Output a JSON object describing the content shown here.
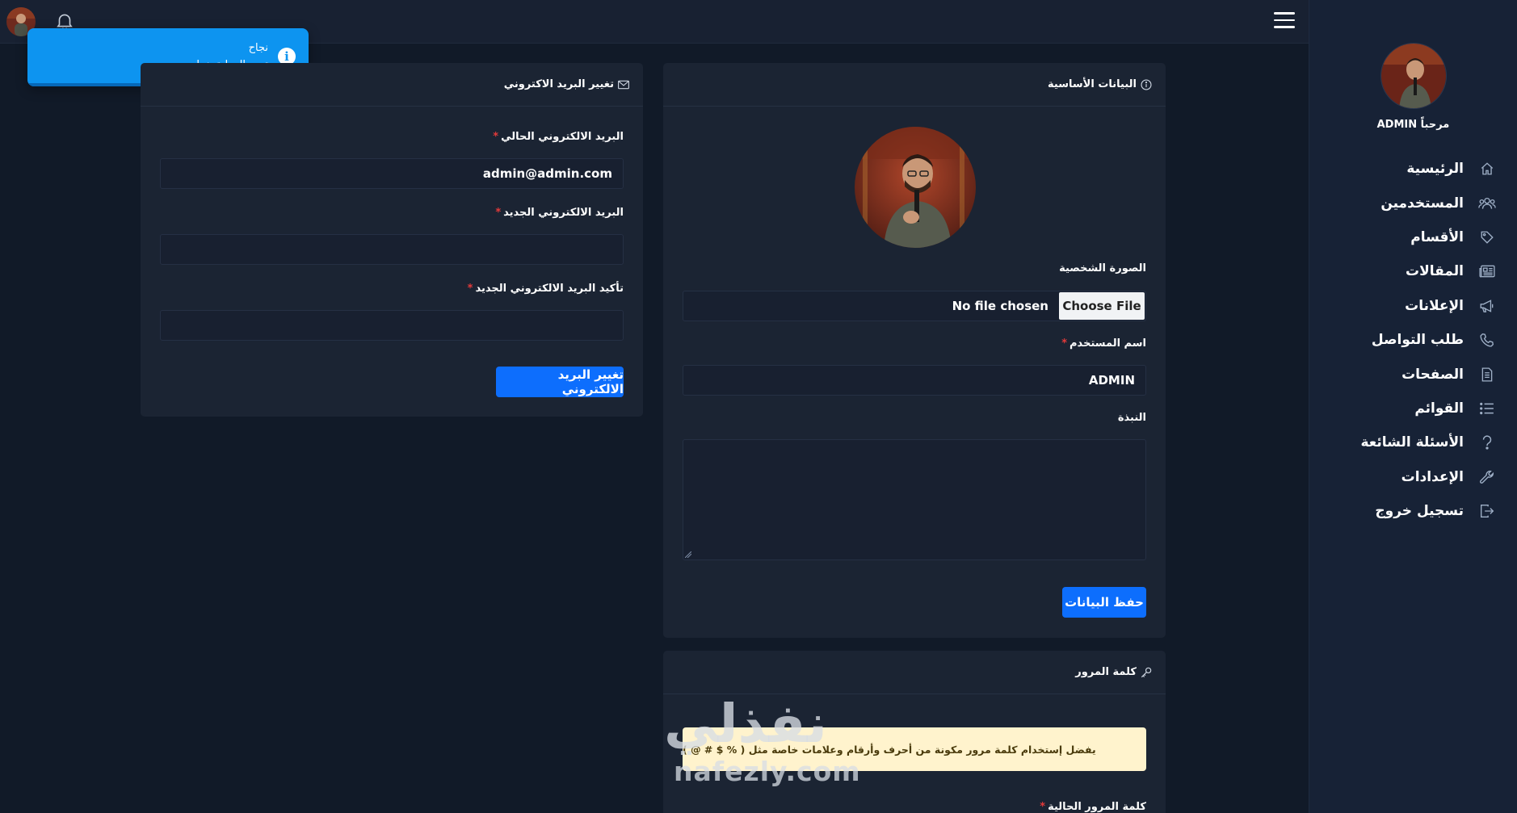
{
  "topbar": {
    "avatar_icon": "user-avatar",
    "notification_icon": "bell-icon",
    "menu_icon": "hamburger-menu-icon"
  },
  "toast": {
    "title": "نجاح",
    "message": "تمت العملية بنجاح",
    "icon": "info-icon",
    "color": "#0d94f0"
  },
  "sidebar": {
    "welcome": "مرحباً ADMIN",
    "items": [
      {
        "label": "الرئيسية",
        "icon": "home-icon"
      },
      {
        "label": "المستخدمين",
        "icon": "users-icon"
      },
      {
        "label": "الأقسام",
        "icon": "tag-icon"
      },
      {
        "label": "المقالات",
        "icon": "newspaper-icon"
      },
      {
        "label": "الإعلانات",
        "icon": "megaphone-icon"
      },
      {
        "label": "طلب التواصل",
        "icon": "phone-icon"
      },
      {
        "label": "الصفحات",
        "icon": "page-icon"
      },
      {
        "label": "القوائم",
        "icon": "list-icon"
      },
      {
        "label": "الأسئلة الشائعة",
        "icon": "question-icon"
      },
      {
        "label": "الإعدادات",
        "icon": "wrench-icon"
      },
      {
        "label": "تسجيل خروج",
        "icon": "logout-icon"
      }
    ]
  },
  "basic_info": {
    "title": "البيانات الأساسية",
    "photo_label": "الصورة الشخصية",
    "file_button": "Choose File",
    "file_status": "No file chosen",
    "username_label": "اسم المستخدم",
    "username_value": "ADMIN",
    "bio_label": "النبذة",
    "bio_value": "",
    "save_button": "حفظ البيانات"
  },
  "email_change": {
    "title": "تغيير البريد الاكتروني",
    "current_label": "البريد الالكتروني الحالي",
    "current_value": "admin@admin.com",
    "new_label": "البريد الالكتروني الجديد",
    "new_value": "",
    "confirm_label": "تأكيد البريد الالكتروني الجديد",
    "confirm_value": "",
    "submit_button": "تغيير البريد الالكتروني"
  },
  "password": {
    "title": "كلمة المرور",
    "hint": "يفضل إستخدام كلمة مرور مكونة من أحرف وأرقام وعلامات خاصة مثل ( % $ # @ )",
    "current_label": "كلمة المرور الحالية"
  },
  "required_mark": "*",
  "watermark": {
    "ar": "نفذلي",
    "en": "nafezly.com"
  },
  "colors": {
    "background": "#111a28",
    "sidebar": "#172236",
    "card": "#1b2433",
    "primary": "#0d6efd",
    "required": "#e33a3a",
    "warning_bg": "#fff3cd"
  }
}
